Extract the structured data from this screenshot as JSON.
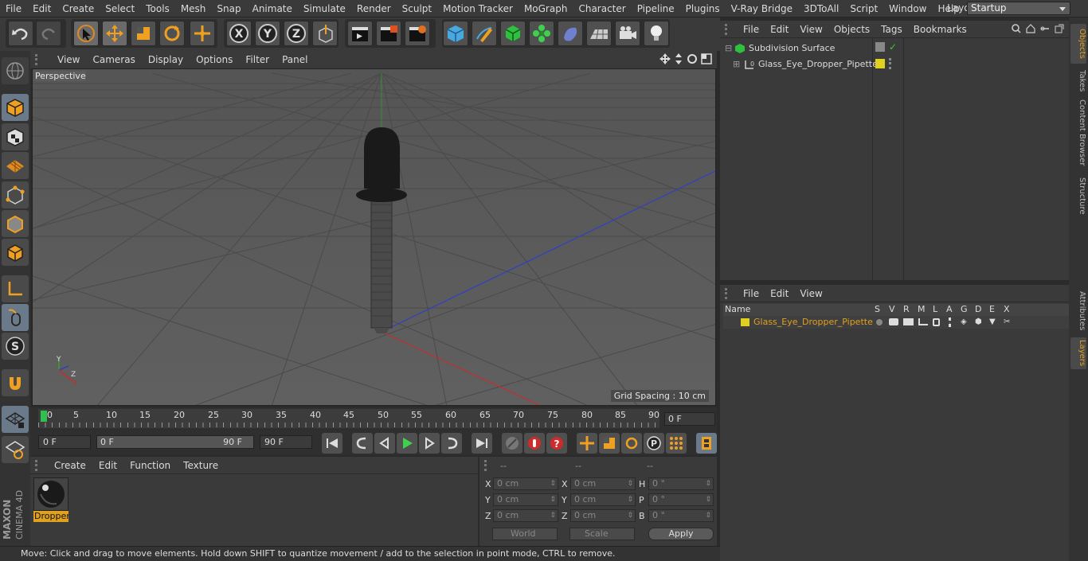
{
  "menu": [
    "File",
    "Edit",
    "Create",
    "Select",
    "Tools",
    "Mesh",
    "Snap",
    "Animate",
    "Simulate",
    "Render",
    "Sculpt",
    "Motion Tracker",
    "MoGraph",
    "Character",
    "Pipeline",
    "Plugins",
    "V-Ray Bridge",
    "3DToAll",
    "Script",
    "Window",
    "Help"
  ],
  "layout": {
    "label": "Layout:",
    "value": "Startup"
  },
  "viewport": {
    "menu": [
      "View",
      "Cameras",
      "Display",
      "Options",
      "Filter",
      "Panel"
    ],
    "label": "Perspective",
    "grid_spacing": "Grid Spacing : 10 cm",
    "axis_labels": {
      "y": "Y",
      "z": "Z",
      "x": "X"
    }
  },
  "timeline": {
    "ticks": [
      "0",
      "5",
      "10",
      "15",
      "20",
      "25",
      "30",
      "35",
      "40",
      "45",
      "50",
      "55",
      "60",
      "65",
      "70",
      "75",
      "80",
      "85",
      "90"
    ],
    "current_frame": "0 F",
    "start_field": "0 F",
    "range_start": "0 F",
    "range_end": "90 F",
    "end_field": "90 F"
  },
  "material": {
    "menu": [
      "Create",
      "Edit",
      "Function",
      "Texture"
    ],
    "name": "Dropper"
  },
  "coords": {
    "headers": [
      "--",
      "--",
      "--"
    ],
    "rows": [
      {
        "a": "X",
        "av": "0 cm",
        "b": "X",
        "bv": "0 cm",
        "c": "H",
        "cv": "0 °"
      },
      {
        "a": "Y",
        "av": "0 cm",
        "b": "Y",
        "bv": "0 cm",
        "c": "P",
        "cv": "0 °"
      },
      {
        "a": "Z",
        "av": "0 cm",
        "b": "Z",
        "bv": "0 cm",
        "c": "B",
        "cv": "0 °"
      }
    ],
    "world": "World",
    "scale": "Scale",
    "apply": "Apply"
  },
  "status": "Move: Click and drag to move elements. Hold down SHIFT to quantize movement / add to the selection in point mode, CTRL to remove.",
  "objects": {
    "menu": [
      "File",
      "Edit",
      "View",
      "Objects",
      "Tags",
      "Bookmarks"
    ],
    "items": [
      "Subdivision Surface",
      "Glass_Eye_Dropper_Pipette"
    ]
  },
  "layers": {
    "menu": [
      "File",
      "Edit",
      "View"
    ],
    "columns": [
      "Name",
      "S",
      "V",
      "R",
      "M",
      "L",
      "A",
      "G",
      "D",
      "E",
      "X"
    ],
    "row": "Glass_Eye_Dropper_Pipette",
    "accent": "#e0c020"
  },
  "right_tabs": [
    "Objects",
    "Takes",
    "Content Browser",
    "Structure",
    "Attributes",
    "Layers"
  ],
  "brand": {
    "line1": "MAXON",
    "line2": "CINEMA 4D"
  }
}
